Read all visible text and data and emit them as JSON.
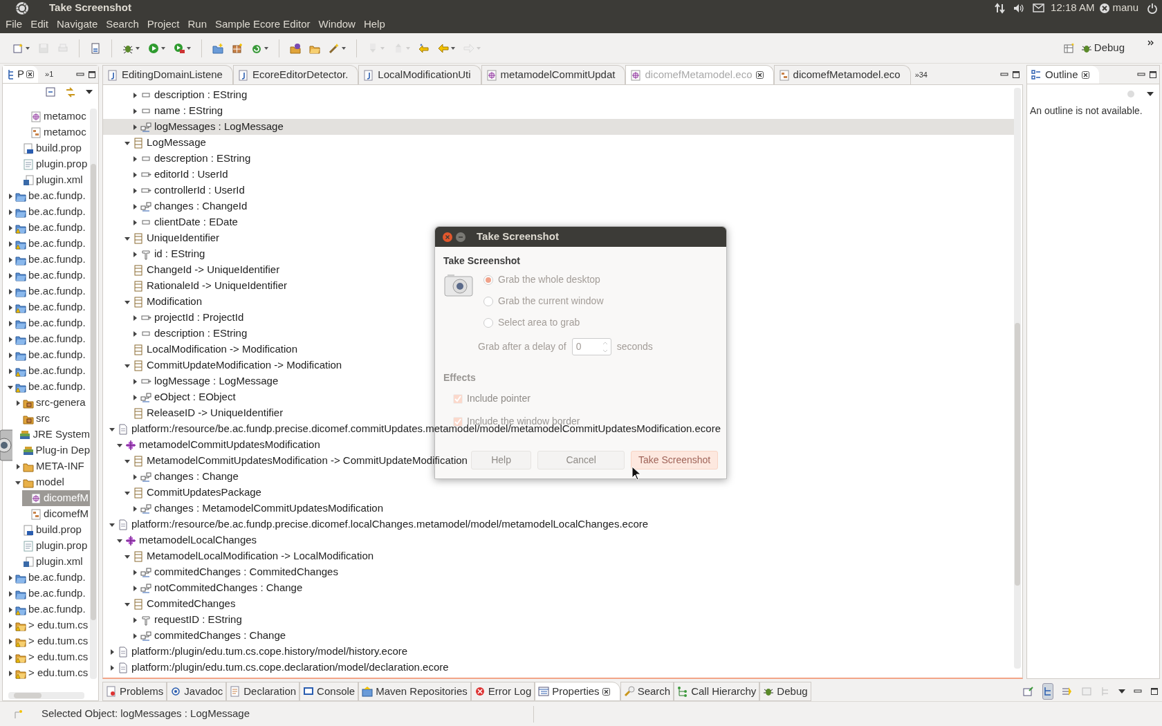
{
  "top_bar": {
    "title": "Take Screenshot",
    "clock": "12:18 AM",
    "user": "manu"
  },
  "menu": [
    "File",
    "Edit",
    "Navigate",
    "Search",
    "Project",
    "Run",
    "Sample Ecore Editor",
    "Window",
    "Help"
  ],
  "toolbar": [
    {
      "kind": "new",
      "disabled": false,
      "dropdown": true
    },
    {
      "kind": "save",
      "disabled": true,
      "dropdown": false
    },
    {
      "kind": "print",
      "disabled": true,
      "dropdown": false
    },
    {
      "kind": "sep"
    },
    {
      "kind": "binary",
      "disabled": false,
      "dropdown": false
    },
    {
      "kind": "sep"
    },
    {
      "kind": "debug",
      "disabled": false,
      "dropdown": true
    },
    {
      "kind": "run",
      "disabled": false,
      "dropdown": true
    },
    {
      "kind": "tools",
      "disabled": false,
      "dropdown": true
    },
    {
      "kind": "sep"
    },
    {
      "kind": "new-package",
      "disabled": false,
      "dropdown": false
    },
    {
      "kind": "new-class",
      "disabled": false,
      "dropdown": false
    },
    {
      "kind": "new-other",
      "disabled": false,
      "dropdown": true
    },
    {
      "kind": "sep"
    },
    {
      "kind": "open-type",
      "disabled": false,
      "dropdown": false
    },
    {
      "kind": "folder",
      "disabled": false,
      "dropdown": false
    },
    {
      "kind": "wand",
      "disabled": false,
      "dropdown": true
    },
    {
      "kind": "sep"
    },
    {
      "kind": "next",
      "disabled": true,
      "dropdown": true
    },
    {
      "kind": "prev",
      "disabled": true,
      "dropdown": true
    },
    {
      "kind": "last-edit",
      "disabled": false,
      "dropdown": false
    },
    {
      "kind": "back",
      "disabled": false,
      "dropdown": true
    },
    {
      "kind": "forward",
      "disabled": true,
      "dropdown": true
    }
  ],
  "perspective": {
    "label": "Debug"
  },
  "explorer": {
    "tab": "P",
    "overflow": "»1",
    "tree": [
      {
        "children": [
          {
            "children": [
              {
                "label": "metamoc",
                "kind": "ecore",
                "selected": false
              },
              {
                "label": "metamoc",
                "kind": "genmodel",
                "selected": false
              }
            ]
          },
          {
            "label": "build.prop",
            "kind": "build",
            "selected": false
          },
          {
            "label": "plugin.prop",
            "kind": "text",
            "selected": false
          },
          {
            "label": "plugin.xml",
            "kind": "xml",
            "selected": false
          }
        ]
      },
      {
        "label": "be.ac.fundp.",
        "kind": "project",
        "expanded": false,
        "selected": false
      },
      {
        "label": "be.ac.fundp.",
        "kind": "project",
        "expanded": false,
        "selected": false
      },
      {
        "label": "be.ac.fundp.",
        "kind": "project-warning",
        "expanded": false,
        "selected": false
      },
      {
        "label": "be.ac.fundp.",
        "kind": "project-warning",
        "expanded": false,
        "selected": false
      },
      {
        "label": "be.ac.fundp.",
        "kind": "project",
        "expanded": false,
        "selected": false
      },
      {
        "label": "be.ac.fundp.",
        "kind": "project",
        "expanded": false,
        "selected": false
      },
      {
        "label": "be.ac.fundp.",
        "kind": "project",
        "expanded": false,
        "selected": false
      },
      {
        "label": "be.ac.fundp.",
        "kind": "project-warning",
        "expanded": false,
        "selected": false
      },
      {
        "label": "be.ac.fundp.",
        "kind": "project",
        "expanded": false,
        "selected": false
      },
      {
        "label": "be.ac.fundp.",
        "kind": "project",
        "expanded": false,
        "selected": false
      },
      {
        "label": "be.ac.fundp.",
        "kind": "project",
        "expanded": false,
        "selected": false
      },
      {
        "label": "be.ac.fundp.",
        "kind": "project-warning",
        "expanded": false,
        "selected": false
      },
      {
        "label": "be.ac.fundp.",
        "kind": "project-warning",
        "expanded": true,
        "selected": false,
        "children": [
          {
            "label": "src-genera",
            "kind": "source",
            "expanded": false,
            "selected": false
          },
          {
            "label": "src",
            "kind": "source",
            "selected": false
          },
          {
            "label": "JRE System",
            "kind": "library",
            "selected": false
          },
          {
            "label": "Plug-in Dep",
            "kind": "library",
            "selected": false
          },
          {
            "label": "META-INF",
            "kind": "folder",
            "expanded": false,
            "selected": false
          },
          {
            "label": "model",
            "kind": "folder",
            "expanded": true,
            "selected": false,
            "children": [
              {
                "label": "dicomefM",
                "kind": "ecore",
                "selected": true
              },
              {
                "label": "dicomefM",
                "kind": "genmodel",
                "selected": false
              }
            ]
          },
          {
            "label": "build.prop",
            "kind": "build",
            "selected": false
          },
          {
            "label": "plugin.prop",
            "kind": "text",
            "selected": false
          },
          {
            "label": "plugin.xml",
            "kind": "xml",
            "selected": false
          }
        ]
      },
      {
        "label": "be.ac.fundp.",
        "kind": "project",
        "expanded": false,
        "selected": false
      },
      {
        "label": "be.ac.fundp.",
        "kind": "project",
        "expanded": false,
        "selected": false
      },
      {
        "label": "be.ac.fundp.",
        "kind": "project-warning",
        "expanded": false,
        "selected": false
      },
      {
        "label": "> edu.tum.cs",
        "kind": "java-warning",
        "expanded": false,
        "selected": false
      },
      {
        "label": "> edu.tum.cs",
        "kind": "java-warning",
        "expanded": false,
        "selected": false
      },
      {
        "label": "> edu.tum.cs",
        "kind": "java-warning",
        "expanded": false,
        "selected": false
      },
      {
        "label": "> edu.tum.cs",
        "kind": "java-warning",
        "expanded": false,
        "selected": false
      }
    ]
  },
  "editor_tabs": [
    {
      "label": "EditingDomainListene",
      "kind": "java",
      "selected": false
    },
    {
      "label": "EcoreEditorDetector.",
      "kind": "java",
      "selected": false
    },
    {
      "label": "LocalModificationUti",
      "kind": "java",
      "selected": false
    },
    {
      "label": "metamodelCommitUpdat",
      "kind": "ecore",
      "selected": false
    },
    {
      "label": "dicomefMetamodel.eco",
      "kind": "ecore",
      "selected": true
    },
    {
      "label": "dicomefMetamodel.eco",
      "kind": "genmodel",
      "selected": false
    }
  ],
  "editor_overflow": "»34",
  "tree": [
    {
      "children": [
        {
          "children": [
            {
              "children": [
                {
                  "label": "description : EString",
                  "kind": "attribute",
                  "expanded": false,
                  "selected": false
                },
                {
                  "label": "name : EString",
                  "kind": "attribute",
                  "expanded": false,
                  "selected": false
                },
                {
                  "label": "logMessages : LogMessage",
                  "kind": "reference",
                  "expanded": false,
                  "selected": true
                }
              ]
            },
            {
              "label": "LogMessage",
              "kind": "class",
              "expanded": true,
              "selected": false,
              "children": [
                {
                  "label": "descreption : EString",
                  "kind": "attribute",
                  "expanded": false,
                  "selected": false
                },
                {
                  "label": "editorId : UserId",
                  "kind": "typed",
                  "expanded": false,
                  "selected": false
                },
                {
                  "label": "controllerId : UserId",
                  "kind": "typed",
                  "expanded": false,
                  "selected": false
                },
                {
                  "label": "changes : ChangeId",
                  "kind": "reference",
                  "expanded": false,
                  "selected": false
                },
                {
                  "label": "clientDate : EDate",
                  "kind": "attribute",
                  "expanded": false,
                  "selected": false
                }
              ]
            },
            {
              "label": "UniqueIdentifier",
              "kind": "class",
              "expanded": true,
              "selected": false,
              "children": [
                {
                  "label": "id : EString",
                  "kind": "key",
                  "expanded": false,
                  "selected": false
                }
              ]
            },
            {
              "label": "ChangeId -> UniqueIdentifier",
              "kind": "class",
              "selected": false
            },
            {
              "label": "RationaleId -> UniqueIdentifier",
              "kind": "class",
              "selected": false
            },
            {
              "label": "Modification",
              "kind": "class",
              "expanded": true,
              "selected": false,
              "children": [
                {
                  "label": "projectId : ProjectId",
                  "kind": "typed",
                  "expanded": false,
                  "selected": false
                },
                {
                  "label": "description : EString",
                  "kind": "attribute",
                  "expanded": false,
                  "selected": false
                }
              ]
            },
            {
              "label": "LocalModification -> Modification",
              "kind": "class",
              "selected": false
            },
            {
              "label": "CommitUpdateModification -> Modification",
              "kind": "class",
              "expanded": true,
              "selected": false,
              "children": [
                {
                  "label": "logMessage : LogMessage",
                  "kind": "typed",
                  "expanded": false,
                  "selected": false
                },
                {
                  "label": "eObject : EObject",
                  "kind": "reference",
                  "expanded": false,
                  "selected": false
                }
              ]
            },
            {
              "label": "ReleaseID -> UniqueIdentifier",
              "kind": "class",
              "selected": false
            }
          ]
        }
      ]
    },
    {
      "label": "platform:/resource/be.ac.fundp.precise.dicomef.commitUpdates.metamodel/model/metamodelCommitUpdatesModification.ecore",
      "kind": "resource",
      "expanded": true,
      "selected": false,
      "children": [
        {
          "label": "metamodelCommitUpdatesModification",
          "kind": "package",
          "expanded": true,
          "selected": false,
          "children": [
            {
              "label": "MetamodelCommitUpdatesModification -> CommitUpdateModification",
              "kind": "class",
              "expanded": true,
              "selected": false,
              "children": [
                {
                  "label": "changes : Change",
                  "kind": "reference",
                  "expanded": false,
                  "selected": false
                }
              ]
            },
            {
              "label": "CommitUpdatesPackage",
              "kind": "class",
              "expanded": true,
              "selected": false,
              "children": [
                {
                  "label": "changes : MetamodelCommitUpdatesModification",
                  "kind": "reference",
                  "expanded": false,
                  "selected": false
                }
              ]
            }
          ]
        }
      ]
    },
    {
      "label": "platform:/resource/be.ac.fundp.precise.dicomef.localChanges.metamodel/model/metamodelLocalChanges.ecore",
      "kind": "resource",
      "expanded": true,
      "selected": false,
      "children": [
        {
          "label": "metamodelLocalChanges",
          "kind": "package",
          "expanded": true,
          "selected": false,
          "children": [
            {
              "label": "MetamodelLocalModification -> LocalModification",
              "kind": "class",
              "expanded": true,
              "selected": false,
              "children": [
                {
                  "label": "commitedChanges : CommitedChanges",
                  "kind": "reference",
                  "expanded": false,
                  "selected": false
                },
                {
                  "label": "notCommitedChanges : Change",
                  "kind": "reference",
                  "expanded": false,
                  "selected": false
                }
              ]
            },
            {
              "label": "CommitedChanges",
              "kind": "class",
              "expanded": true,
              "selected": false,
              "children": [
                {
                  "label": "requestID : EString",
                  "kind": "key",
                  "expanded": false,
                  "selected": false
                },
                {
                  "label": "commitedChanges : Change",
                  "kind": "reference",
                  "expanded": false,
                  "selected": false
                }
              ]
            }
          ]
        }
      ]
    },
    {
      "label": "platform:/plugin/edu.tum.cs.cope.history/model/history.ecore",
      "kind": "resource",
      "expanded": false,
      "selected": false
    },
    {
      "label": "platform:/plugin/edu.tum.cs.cope.declaration/model/declaration.ecore",
      "kind": "resource",
      "expanded": false,
      "selected": false
    }
  ],
  "outline": {
    "tab": "Outline",
    "message": "An outline is not available."
  },
  "bottom_tabs": [
    {
      "label": "Problems",
      "kind": "problems",
      "selected": false
    },
    {
      "label": "Javadoc",
      "kind": "javadoc",
      "selected": false
    },
    {
      "label": "Declaration",
      "kind": "declaration",
      "selected": false
    },
    {
      "label": "Console",
      "kind": "console",
      "selected": false
    },
    {
      "label": "Maven Repositories",
      "kind": "maven",
      "selected": false
    },
    {
      "label": "Error Log",
      "kind": "error",
      "selected": false
    },
    {
      "label": "Properties",
      "kind": "properties",
      "selected": true
    },
    {
      "label": "Search",
      "kind": "search",
      "selected": false
    },
    {
      "label": "Call Hierarchy",
      "kind": "hierarchy",
      "selected": false
    },
    {
      "label": "Debug",
      "kind": "debug",
      "selected": false
    }
  ],
  "status_bar": "Selected Object: logMessages : LogMessage",
  "dialog": {
    "title": "Take Screenshot",
    "heading": "Take Screenshot",
    "options": [
      {
        "label": "Grab the whole desktop",
        "selected": true
      },
      {
        "label": "Grab the current window",
        "selected": false
      },
      {
        "label": "Select area to grab",
        "selected": false
      }
    ],
    "delay_label": "Grab after a delay of",
    "delay": "0",
    "delay_unit": "seconds",
    "effects": "Effects",
    "checks": [
      {
        "label": "Include pointer",
        "checked": true
      },
      {
        "label": "Include the window border",
        "checked": true
      }
    ],
    "buttons": [
      {
        "label": "Help",
        "default": false
      },
      {
        "label": "Cancel",
        "default": false
      },
      {
        "label": "Take Screenshot",
        "default": true
      }
    ]
  }
}
